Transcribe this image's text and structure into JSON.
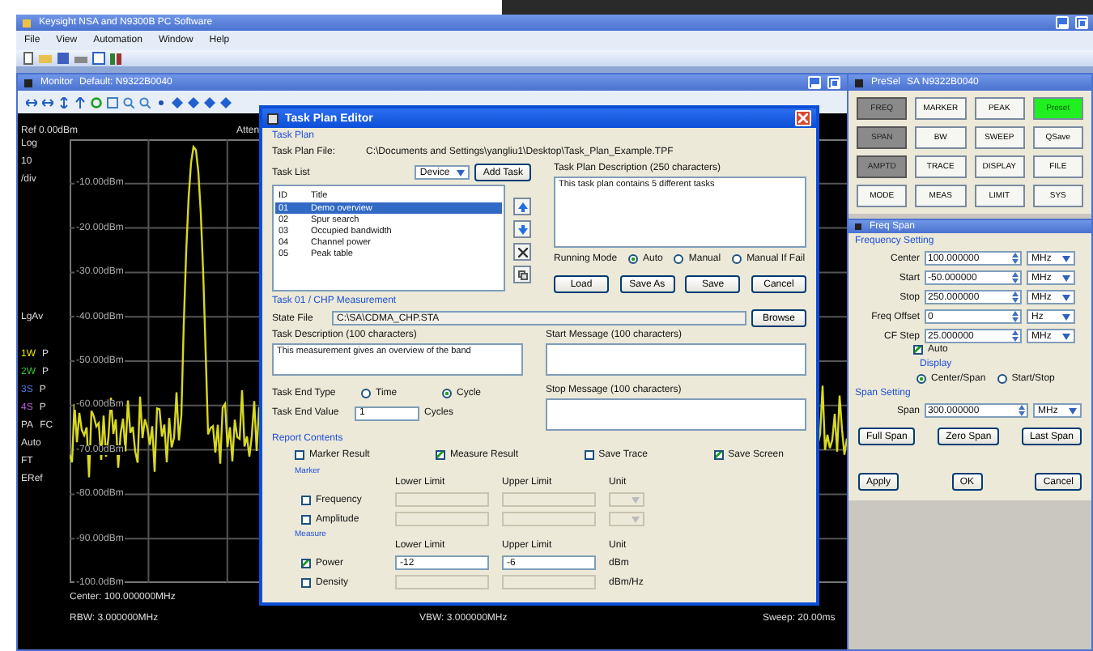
{
  "app": {
    "title": "Keysight NSA and N9300B PC Software",
    "menu": [
      "File",
      "View",
      "Automation",
      "Window",
      "Help"
    ]
  },
  "monitor": {
    "title": "Monitor",
    "device": "Default: N9322B0040",
    "ref": "Ref 0.00dBm",
    "atten": "Atten",
    "scale": [
      "Log",
      "10",
      "/div"
    ],
    "detector": "LgAv",
    "traces": [
      {
        "label": "1W",
        "mode": "P",
        "color": "#e8e800"
      },
      {
        "label": "2W",
        "mode": "P",
        "color": "#40c040"
      },
      {
        "label": "3S",
        "mode": "P",
        "color": "#4a7ff0"
      },
      {
        "label": "4S",
        "mode": "P",
        "color": "#c060e0"
      }
    ],
    "indicators": [
      [
        "PA",
        "FC"
      ],
      [
        "Auto"
      ],
      [
        "FT"
      ],
      [
        "ERef"
      ]
    ],
    "grid_labels": [
      "-10.00dBm",
      "-20.00dBm",
      "-30.00dBm",
      "-40.00dBm",
      "-50.00dBm",
      "-60.00dBm",
      "-70.00dBm",
      "-80.00dBm",
      "-90.00dBm",
      "-100.0dBm"
    ],
    "footer": {
      "center": "Center: 100.000000MHz",
      "rbw": "RBW: 3.000000MHz",
      "vbw": "VBW: 3.000000MHz",
      "sweep": "Sweep: 20.00ms"
    }
  },
  "task_plan_editor": {
    "title": "Task Plan Editor",
    "task_plan": {
      "group": "Task Plan",
      "file_label": "Task Plan File:",
      "file": "C:\\Documents and Settings\\yangliu1\\Desktop\\Task_Plan_Example.TPF",
      "list_label": "Task List",
      "device": "Device",
      "add_task": "Add Task",
      "columns": [
        "ID",
        "Title"
      ],
      "tasks": [
        {
          "id": "01",
          "title": "Demo overview",
          "selected": true
        },
        {
          "id": "02",
          "title": "Spur search",
          "selected": false
        },
        {
          "id": "03",
          "title": "Occupied bandwidth",
          "selected": false
        },
        {
          "id": "04",
          "title": "Channel power",
          "selected": false
        },
        {
          "id": "05",
          "title": "Peak table",
          "selected": false
        }
      ],
      "description_label": "Task Plan Description (250 characters)",
      "description": "This task plan contains 5 different tasks",
      "running_mode_label": "Running Mode",
      "running_modes": [
        {
          "label": "Auto",
          "selected": true
        },
        {
          "label": "Manual",
          "selected": false
        },
        {
          "label": "Manual If Fail",
          "selected": false
        }
      ],
      "buttons": [
        "Load",
        "Save As",
        "Save",
        "Cancel"
      ]
    },
    "task": {
      "group": "Task 01 / CHP Measurement",
      "state_file_label": "State File",
      "state_file": "C:\\SA\\CDMA_CHP.STA",
      "browse": "Browse",
      "description_label": "Task Description (100 characters)",
      "description": "This measurement gives an overview of the band",
      "start_message_label": "Start Message (100 characters)",
      "stop_message_label": "Stop Message (100 characters)",
      "end_type_label": "Task End Type",
      "end_types": [
        {
          "label": "Time",
          "selected": false
        },
        {
          "label": "Cycle",
          "selected": true
        }
      ],
      "end_value_label": "Task End Value",
      "end_value": "1",
      "end_value_unit": "Cycles"
    },
    "report": {
      "group": "Report Contents",
      "options": [
        {
          "label": "Marker Result",
          "checked": false
        },
        {
          "label": "Measure Result",
          "checked": true
        },
        {
          "label": "Save Trace",
          "checked": false
        },
        {
          "label": "Save Screen",
          "checked": true
        }
      ],
      "sections": [
        {
          "title": "Marker",
          "columns": [
            "Lower Limit",
            "Upper Limit",
            "Unit"
          ],
          "rows": [
            {
              "label": "Frequency",
              "checked": false,
              "disabled": true
            },
            {
              "label": "Amplitude",
              "checked": false,
              "disabled": true
            }
          ]
        },
        {
          "title": "Measure",
          "columns": [
            "Lower Limit",
            "Upper Limit",
            "Unit"
          ],
          "rows": [
            {
              "label": "Power",
              "checked": true,
              "disabled": false,
              "lower": "-12",
              "upper": "-6",
              "unit": "dBm"
            },
            {
              "label": "Density",
              "checked": false,
              "disabled": true,
              "unit": "dBm/Hz"
            }
          ]
        }
      ]
    }
  },
  "panel": {
    "title": "PreSel",
    "device": "SA N9322B0040",
    "keys": [
      {
        "label": "FREQ",
        "kind": "dark"
      },
      {
        "label": "MARKER",
        "kind": "normal"
      },
      {
        "label": "PEAK",
        "kind": "normal"
      },
      {
        "label": "Preset",
        "kind": "preset"
      },
      {
        "label": "SPAN",
        "kind": "dark"
      },
      {
        "label": "BW",
        "kind": "normal"
      },
      {
        "label": "SWEEP",
        "kind": "normal"
      },
      {
        "label": "QSave",
        "kind": "normal"
      },
      {
        "label": "AMPTD",
        "kind": "dark"
      },
      {
        "label": "TRACE",
        "kind": "normal"
      },
      {
        "label": "DISPLAY",
        "kind": "normal"
      },
      {
        "label": "FILE",
        "kind": "normal"
      },
      {
        "label": "MODE",
        "kind": "normal"
      },
      {
        "label": "MEAS",
        "kind": "normal"
      },
      {
        "label": "LIMIT",
        "kind": "normal"
      },
      {
        "label": "SYS",
        "kind": "normal"
      }
    ],
    "freq_span": {
      "title": "Freq Span",
      "group": "Frequency Setting",
      "fields": [
        {
          "label": "Center",
          "value": "100.000000",
          "unit": "MHz"
        },
        {
          "label": "Start",
          "value": "-50.000000",
          "unit": "MHz"
        },
        {
          "label": "Stop",
          "value": "250.000000",
          "unit": "MHz"
        },
        {
          "label": "Freq Offset",
          "value": "0",
          "unit": "Hz"
        },
        {
          "label": "CF Step",
          "value": "25.000000",
          "unit": "MHz"
        }
      ],
      "auto": {
        "label": "Auto",
        "checked": true
      },
      "display_label": "Display",
      "display_options": [
        {
          "label": "Center/Span",
          "selected": true
        },
        {
          "label": "Start/Stop",
          "selected": false
        }
      ],
      "span_group": "Span Setting",
      "span": {
        "label": "Span",
        "value": "300.000000",
        "unit": "MHz"
      },
      "span_buttons": [
        "Full Span",
        "Zero Span",
        "Last Span"
      ],
      "buttons": [
        "Apply",
        "OK",
        "Cancel"
      ]
    }
  }
}
